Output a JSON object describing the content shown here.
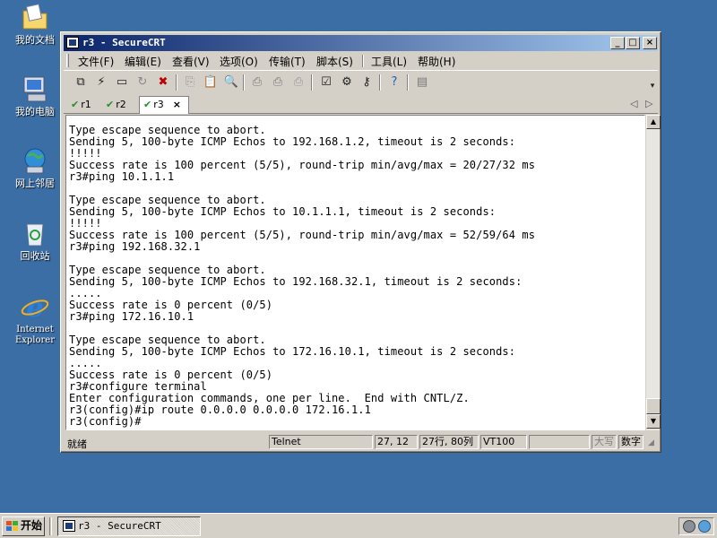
{
  "desktop": {
    "icons": [
      {
        "label": "我的文档",
        "icon": "my-documents-icon"
      },
      {
        "label": "我的电脑",
        "icon": "my-computer-icon"
      },
      {
        "label": "网上邻居",
        "icon": "network-places-icon"
      },
      {
        "label": "回收站",
        "icon": "recycle-bin-icon"
      },
      {
        "label": "Internet Explorer",
        "icon": "internet-explorer-icon"
      }
    ]
  },
  "window": {
    "title": "r3 - SecureCRT",
    "controls": {
      "minimize": "_",
      "maximize": "□",
      "close": "×"
    }
  },
  "menu": {
    "items": [
      "文件(F)",
      "编辑(E)",
      "查看(V)",
      "选项(O)",
      "传输(T)",
      "脚本(S)",
      "工具(L)",
      "帮助(H)"
    ]
  },
  "toolbar": {
    "icons": [
      "connect-icon",
      "quick-connect-icon",
      "connect-in-tab-icon",
      "reconnect-icon",
      "disconnect-icon",
      "copy-icon",
      "paste-icon",
      "find-icon",
      "print-icon",
      "print-selection-icon",
      "print-setup-icon",
      "session-options-icon",
      "global-options-icon",
      "keymap-icon",
      "help-icon",
      "sftp-icon"
    ]
  },
  "tabs": {
    "items": [
      {
        "label": "r1",
        "active": false
      },
      {
        "label": "r2",
        "active": false
      },
      {
        "label": "r3",
        "active": true
      }
    ],
    "close_glyph": "×",
    "nav_left": "◁",
    "nav_right": "▷"
  },
  "terminal": {
    "lines": [
      "Type escape sequence to abort.",
      "Sending 5, 100-byte ICMP Echos to 192.168.1.2, timeout is 2 seconds:",
      "!!!!!",
      "Success rate is 100 percent (5/5), round-trip min/avg/max = 20/27/32 ms",
      "r3#ping 10.1.1.1",
      "",
      "Type escape sequence to abort.",
      "Sending 5, 100-byte ICMP Echos to 10.1.1.1, timeout is 2 seconds:",
      "!!!!!",
      "Success rate is 100 percent (5/5), round-trip min/avg/max = 52/59/64 ms",
      "r3#ping 192.168.32.1",
      "",
      "Type escape sequence to abort.",
      "Sending 5, 100-byte ICMP Echos to 192.168.32.1, timeout is 2 seconds:",
      ".....",
      "Success rate is 0 percent (0/5)",
      "r3#ping 172.16.10.1",
      "",
      "Type escape sequence to abort.",
      "Sending 5, 100-byte ICMP Echos to 172.16.10.1, timeout is 2 seconds:",
      ".....",
      "Success rate is 0 percent (0/5)",
      "r3#configure terminal",
      "Enter configuration commands, one per line.  End with CNTL/Z.",
      "r3(config)#ip route 0.0.0.0 0.0.0.0 172.16.1.1",
      "r3(config)#"
    ]
  },
  "status": {
    "ready": "就绪",
    "protocol": "Telnet",
    "cursor": "27, 12",
    "size": "27行, 80列",
    "emulation": "VT100",
    "caps": "大写",
    "num": "数字"
  },
  "taskbar": {
    "start_label": "开始",
    "task_label": "r3 - SecureCRT"
  },
  "colors": {
    "desktop": "#3a6ea5",
    "title_gradient_start": "#0a246a",
    "title_gradient_end": "#a6caf0",
    "chrome": "#d4d0c8"
  }
}
